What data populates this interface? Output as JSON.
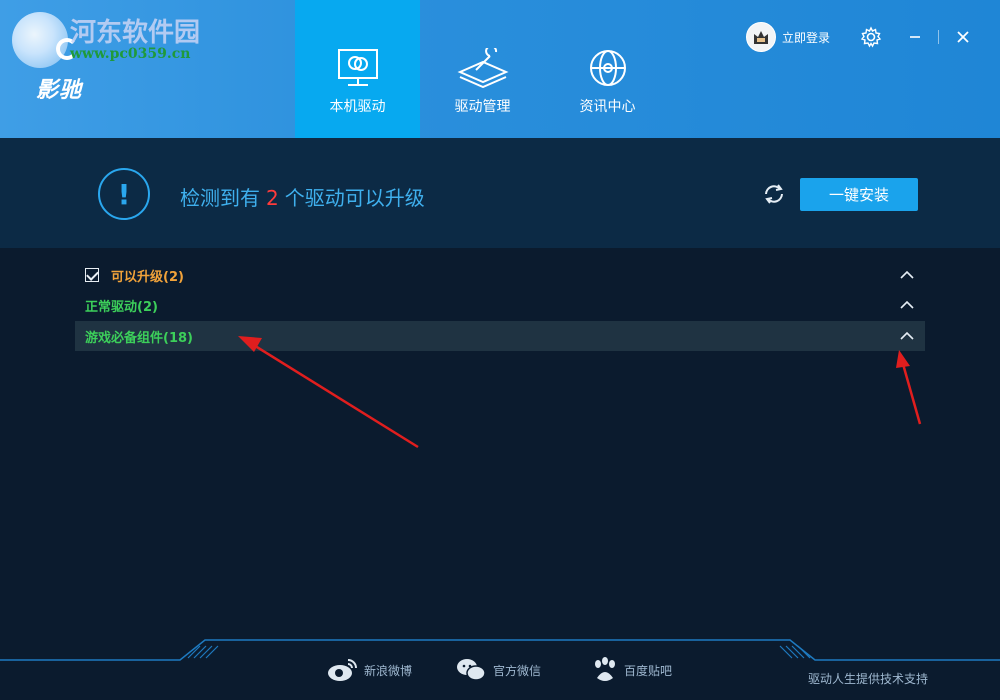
{
  "watermark": {
    "site_name": "河东软件园",
    "url": "www.pc0359.cn"
  },
  "brand": {
    "name": "影驰"
  },
  "nav": {
    "tabs": [
      {
        "label": "本机驱动",
        "icon": "monitor-icon",
        "active": true
      },
      {
        "label": "驱动管理",
        "icon": "wrench-stack-icon",
        "active": false
      },
      {
        "label": "资讯中心",
        "icon": "globe-icon",
        "active": false
      }
    ]
  },
  "header": {
    "login_label": "立即登录"
  },
  "status": {
    "prefix": "检测到有",
    "count": "2",
    "suffix": "个驱动可以升级",
    "install_button": "一键安装"
  },
  "list": {
    "groups": [
      {
        "label": "可以升级(2)",
        "color": "#f2a33a",
        "checked": true
      },
      {
        "label": "正常驱动(2)",
        "color": "#3ccf5a"
      },
      {
        "label": "游戏必备组件(18)",
        "color": "#3ccf5a",
        "highlighted": true
      }
    ]
  },
  "footer": {
    "links": [
      {
        "label": "新浪微博",
        "icon": "weibo-icon"
      },
      {
        "label": "官方微信",
        "icon": "wechat-icon"
      },
      {
        "label": "百度贴吧",
        "icon": "baidu-paw-icon"
      }
    ],
    "support": "驱动人生提供技术支持"
  },
  "colors": {
    "accent": "#07a9f0",
    "alert_number": "#ff3b3b",
    "arrow": "#e01e1e"
  }
}
